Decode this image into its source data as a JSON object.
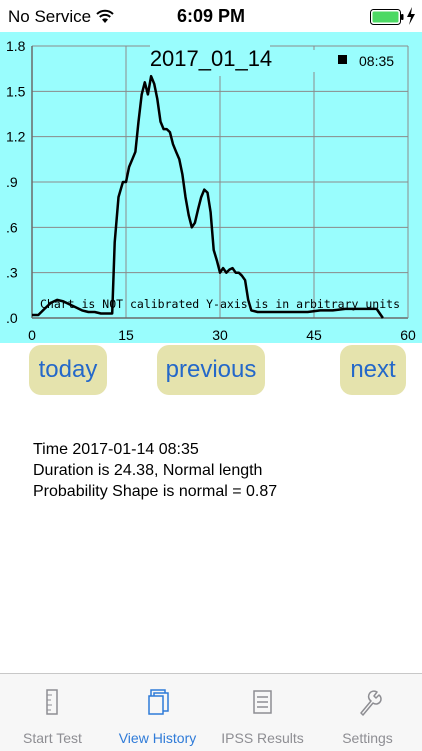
{
  "status_bar": {
    "carrier": "No Service",
    "time": "6:09 PM",
    "wifi_icon": "wifi-icon",
    "battery_icon": "battery-charging-icon",
    "battery_color": "#4cd964"
  },
  "chart": {
    "background_color": "#99fdfd",
    "title": "2017_01_14",
    "legend_label": "08:35",
    "note": "Chart is NOT calibrated Y-axis is in arbitrary units",
    "x_tick_labels": [
      "0",
      "15",
      "30",
      "45",
      "60"
    ],
    "y_tick_labels": [
      ".0",
      ".3",
      ".6",
      ".9",
      "1.2",
      "1.5",
      "1.8"
    ]
  },
  "chart_data": {
    "type": "line",
    "title": "2017_01_14",
    "xlim": [
      0,
      60
    ],
    "ylim": [
      0,
      1.8
    ],
    "grid": true,
    "legend": "top-right",
    "series": [
      {
        "name": "08:35",
        "color": "#000000",
        "x": [
          0,
          1,
          2,
          3,
          4,
          5,
          6,
          7,
          8,
          9,
          10,
          11,
          12,
          12.8,
          13.2,
          13.8,
          14.5,
          15,
          15.5,
          16,
          16.5,
          17,
          17.5,
          18,
          18.5,
          19,
          19.5,
          20,
          20.5,
          21,
          21.5,
          22,
          22.5,
          23,
          23.5,
          24,
          24.5,
          25,
          25.5,
          26,
          26.5,
          27,
          27.5,
          28,
          28.5,
          29,
          29.5,
          30,
          30.5,
          31,
          31.5,
          32,
          32.5,
          33,
          33.5,
          34,
          34.5,
          35,
          36,
          38,
          40,
          42,
          44,
          46,
          48,
          50,
          52,
          54,
          55,
          55.5,
          56
        ],
        "y": [
          0.02,
          0.02,
          0.06,
          0.1,
          0.12,
          0.11,
          0.09,
          0.07,
          0.05,
          0.04,
          0.04,
          0.03,
          0.03,
          0.03,
          0.5,
          0.8,
          0.9,
          0.9,
          1.0,
          1.05,
          1.1,
          1.3,
          1.48,
          1.56,
          1.48,
          1.6,
          1.55,
          1.45,
          1.3,
          1.25,
          1.25,
          1.23,
          1.15,
          1.1,
          1.05,
          0.95,
          0.8,
          0.68,
          0.6,
          0.63,
          0.72,
          0.8,
          0.85,
          0.83,
          0.7,
          0.45,
          0.38,
          0.3,
          0.33,
          0.3,
          0.32,
          0.33,
          0.3,
          0.3,
          0.28,
          0.25,
          0.12,
          0.05,
          0.04,
          0.04,
          0.04,
          0.04,
          0.04,
          0.05,
          0.05,
          0.06,
          0.06,
          0.06,
          0.06,
          0.03,
          0.0
        ]
      }
    ]
  },
  "buttons": {
    "today": "today",
    "previous": "previous",
    "next": "next",
    "text_color": "#2468c9",
    "background_color": "#e5e3ad"
  },
  "info": {
    "time_line": "Time 2017-01-14 08:35",
    "duration_line": "Duration is 24.38, Normal length",
    "probability_line": "Probability Shape is normal =  0.87"
  },
  "tabbar": {
    "active_color": "#2f7bd8",
    "inactive_color": "#8e8e93",
    "tabs": [
      {
        "label": "Start Test",
        "icon": "ruler-icon",
        "active": false
      },
      {
        "label": "View History",
        "icon": "history-icon",
        "active": true
      },
      {
        "label": "IPSS Results",
        "icon": "list-icon",
        "active": false
      },
      {
        "label": "Settings",
        "icon": "wrench-icon",
        "active": false
      }
    ]
  }
}
